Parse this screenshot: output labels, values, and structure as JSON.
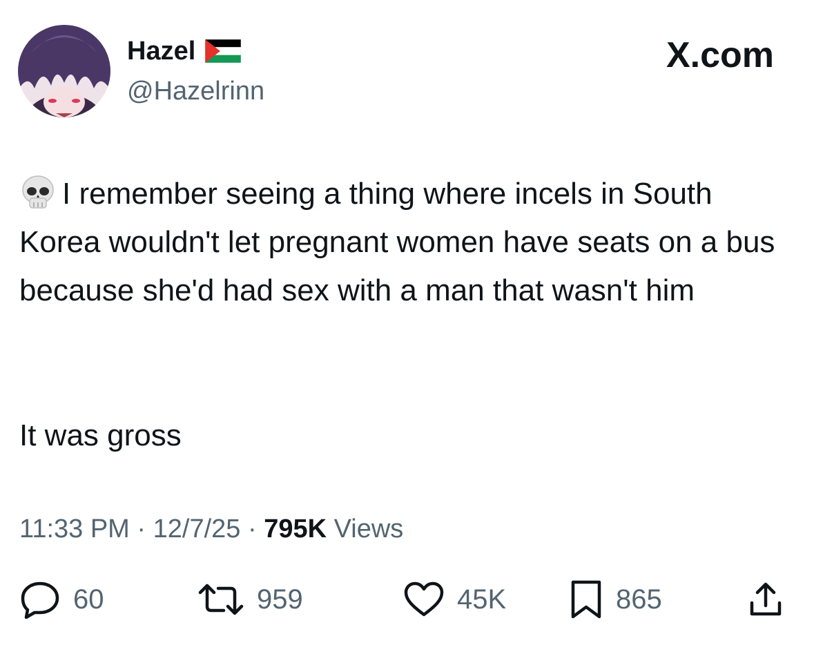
{
  "header": {
    "display_name": "Hazel",
    "flag_icon": "palestine-flag-icon",
    "handle": "@Hazelrinn",
    "site_logo": "X.com"
  },
  "tweet": {
    "emoji_icon": "skull-icon",
    "paragraphs": [
      "I remember seeing a thing where incels in South Korea wouldn't let pregnant women have seats on a bus because she'd had sex with a man that wasn't him",
      "It was gross"
    ]
  },
  "meta": {
    "time": "11:33 PM",
    "date": "12/7/25",
    "separator": "·",
    "views_count": "795K",
    "views_label": "Views"
  },
  "actions": {
    "replies": "60",
    "reposts": "959",
    "likes": "45K",
    "bookmarks": "865"
  },
  "colors": {
    "text": "#0f1419",
    "secondary": "#536471",
    "background": "#ffffff"
  }
}
